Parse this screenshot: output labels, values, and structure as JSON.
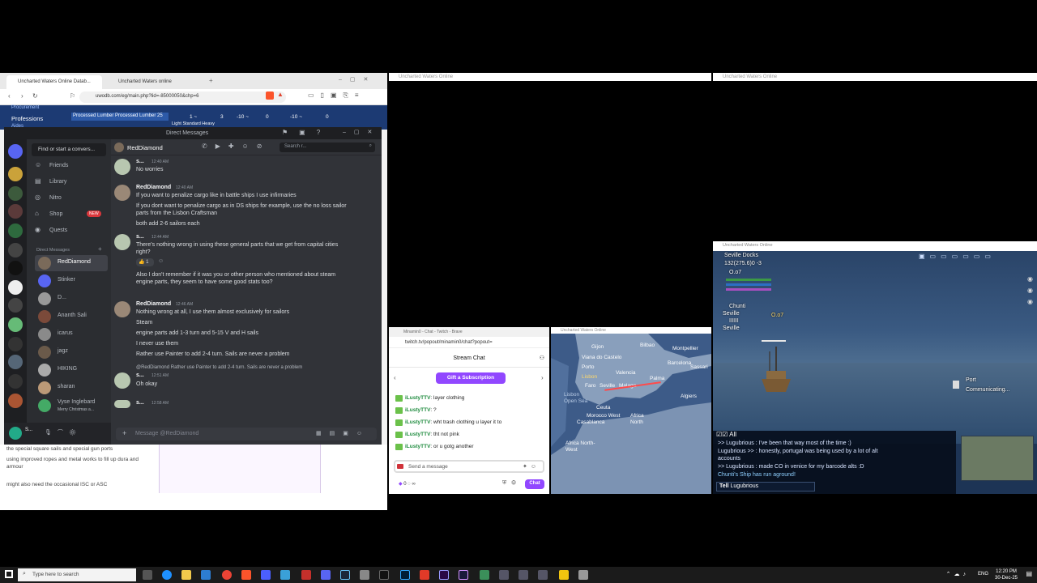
{
  "browser": {
    "tabs": [
      "Uncharted Waters Online Datab...",
      "Uncharted Waters online"
    ],
    "url": "uwodb.com/eg/main.php?lid=-85000050&chp=6",
    "web_nav": [
      "Procurement",
      "Professions",
      "Aides"
    ],
    "web_row": {
      "item": "Processed Lumber Processed Lumber 25",
      "subtitle": "Light Standard Heavy",
      "values": [
        "1 ~",
        "3",
        "-10 ~",
        "0",
        "-10 ~",
        "0"
      ]
    },
    "bg_doc_lines": [
      "the special square sails and special gun ports",
      "using improved ropes and metal works to fill up dura and armour",
      "might also need the occasional ISC or ASC"
    ]
  },
  "discord": {
    "title": "Direct Messages",
    "find": "Find or start a convers...",
    "nav": [
      {
        "label": "Friends",
        "icon": "friends-icon"
      },
      {
        "label": "Library",
        "icon": "library-icon"
      },
      {
        "label": "Nitro",
        "icon": "nitro-icon"
      },
      {
        "label": "Shop",
        "icon": "shop-icon",
        "badge": "NEW"
      },
      {
        "label": "Quests",
        "icon": "quests-icon"
      }
    ],
    "dm_heading": "Direct Messages",
    "dms": [
      {
        "name": "RedDiamond"
      },
      {
        "name": "Stinker"
      },
      {
        "name": "D..."
      },
      {
        "name": "Ananth Sali"
      },
      {
        "name": "icarus"
      },
      {
        "name": "jagz"
      },
      {
        "name": "HIKING"
      },
      {
        "name": "sharan"
      },
      {
        "name": "Vyse Inglebard",
        "sub": "Merry Christmas a..."
      }
    ],
    "user": "S...",
    "channel": "RedDiamond",
    "search_placeholder": "Search r...",
    "input_placeholder": "Message @RedDiamond",
    "messages": [
      {
        "author": "s...",
        "time": "12:40 AM",
        "lines": [
          "No worries"
        ]
      },
      {
        "author": "RedDiamond",
        "time": "12:40 AM",
        "lines": [
          "If you want to penalize cargo like in battle ships I use infirmaries",
          "If you dont want to penalize cargo as in DS ships for example, use the no loss sailor",
          "parts from the Lisbon Craftsman",
          "both add 2-6 sailors each"
        ]
      },
      {
        "author": "s...",
        "time": "12:44 AM",
        "lines": [
          "There's nothing wrong in using these general parts that we get from capital cities",
          "right?",
          "Also I don't remember if it was you or other person who mentioned about steam",
          "engine parts, they seem to have some good stats too?"
        ],
        "reaction": "1"
      },
      {
        "author": "RedDiamond",
        "time": "12:46 AM",
        "lines": [
          "Nothing wrong at all, I use them almost exclusively for sailors",
          "Steam",
          "engine parts add 1-3 turn and 5-15 V and H sails",
          "I never use them",
          "Rather use Painter to add 2-4 turn. Sails are never a problem"
        ]
      },
      {
        "author": "s...",
        "time": "12:51 AM",
        "reply": "@RedDiamond Rather use Painter to add 2-4 turn. Sails are never a problem",
        "lines": [
          "Oh okay"
        ]
      },
      {
        "author": "s...",
        "time": "12:58 AM",
        "lines": []
      }
    ]
  },
  "game_windows": {
    "title": "Uncharted Waters Online"
  },
  "twitch": {
    "tab": "Minamin0 - Chat - Twitch - Brave",
    "url": "twitch.tv/popout/minamin0/chat?popout=",
    "header": "Stream Chat",
    "gift": "Gift a Subscription",
    "messages": [
      {
        "user": "iLustyTTV",
        "text": ": layer clothing"
      },
      {
        "user": "iLustyTTV",
        "text": ": ?"
      },
      {
        "user": "iLustyTTV",
        "text": ": wht trash clothing u layer it to"
      },
      {
        "user": "iLustyTTV",
        "text": ": tht not pink"
      },
      {
        "user": "iLustyTTV",
        "text": ": or u gotg another"
      }
    ],
    "input_placeholder": "Send a message",
    "points": "0",
    "chat_button": "Chat"
  },
  "map": {
    "title": "Uncharted Waters Online",
    "labels": [
      "Gijon",
      "Bilbao",
      "Montpellier",
      "Viana do Castelo",
      "Barcelona",
      "Porto",
      "Valencia",
      "Lisbon",
      "Faro",
      "Seville",
      "Malaga",
      "Palma",
      "Sassari",
      "Lisbon Open Sea",
      "Ceuta",
      "Algiers",
      "Morocco West",
      "Casablanca",
      "Africa North",
      "Africa North-West"
    ]
  },
  "game": {
    "location": "Seville Docks",
    "coords": "132(275.6)0 -3",
    "player_tag": "O.o7",
    "lines_top": [
      "Chunti",
      "Seville",
      "IIIIII",
      "Seville"
    ],
    "ship_label": "O.o7",
    "port_label": "Port",
    "status": "Communicating...",
    "chat_tab": "All",
    "chat": [
      ">> Lugubrious    : I've been that way most of the time :)",
      "Lugubrious >>    : honestly, portugal was being used by a lot of alt",
      "                       accounts",
      ">> Lugubrious    : made CO in venice for my barcode alts :D",
      "Chunti's Ship has run aground!"
    ],
    "tell_label": "Tell",
    "tell_target": "Lugubrious"
  },
  "taskbar": {
    "search": "Type here to search",
    "lang": "ENG",
    "time": "12:20 PM",
    "date": "30-Dec-25"
  }
}
